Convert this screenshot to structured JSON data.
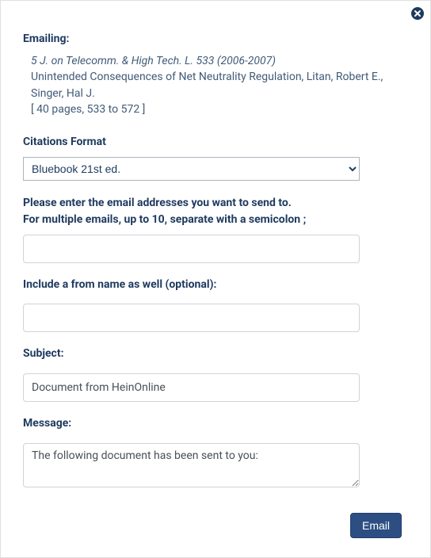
{
  "header": {
    "emailing_label": "Emailing:"
  },
  "document": {
    "citation": "5 J. on Telecomm. & High Tech. L. 533 (2006-2007)",
    "title": "Unintended Consequences of Net Neutrality Regulation, Litan, Robert E., Singer, Hal J.",
    "pages": "[ 40 pages, 533 to 572 ]"
  },
  "citations": {
    "label": "Citations Format",
    "selected": "Bluebook 21st ed."
  },
  "recipients": {
    "label_line1": "Please enter the email addresses you want to send to.",
    "label_line2": "For multiple emails, up to 10, separate with a semicolon ;",
    "value": ""
  },
  "from_name": {
    "label": "Include a from name as well (optional):",
    "value": ""
  },
  "subject": {
    "label": "Subject:",
    "value": "Document from HeinOnline"
  },
  "message": {
    "label": "Message:",
    "value": "The following document has been sent to you:"
  },
  "buttons": {
    "email": "Email"
  }
}
